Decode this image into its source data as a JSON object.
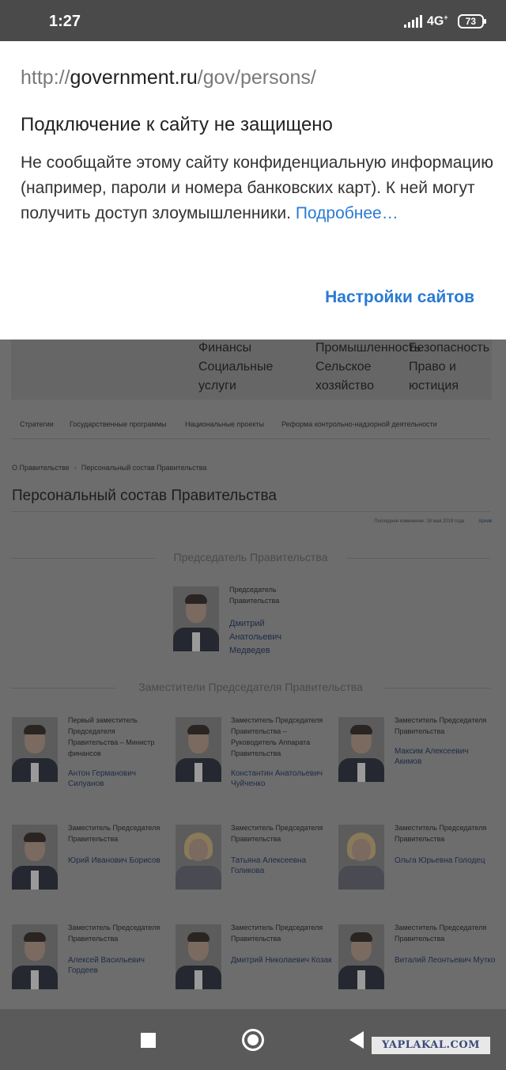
{
  "status_bar": {
    "time": "1:27",
    "network": "4G",
    "network_sup": "+",
    "battery": "73"
  },
  "popup": {
    "url_scheme": "http://",
    "url_domain": "government.ru",
    "url_path": "/gov/persons/",
    "title": "Подключение к сайту не защищено",
    "message": "Не сообщайте этому сайту конфиденциальную информацию (например, пароли и номера банковских карт). К ней могут получить доступ злоумышленники.",
    "more_link": "Подробнее…",
    "settings_button": "Настройки сайтов"
  },
  "menu": {
    "col1": [
      "Финансы",
      "Социальные",
      "услуги"
    ],
    "col2": [
      "Промышленность",
      "Сельское",
      "хозяйство"
    ],
    "col3": [
      "Безопасность",
      "Право и",
      "юстиция"
    ]
  },
  "subnav": [
    "Стратегии",
    "Государственные программы",
    "Национальные проекты",
    "Реформа контрольно-надзорной деятельности"
  ],
  "breadcrumb": [
    "О Правительстве",
    "Персональный состав Правительства"
  ],
  "page_title": "Персональный состав Правительства",
  "updated": {
    "text": "Последнее изменение: 18 мая 2018 года",
    "archive": "Архив"
  },
  "chairman_section": "Председатель Правительства",
  "chairman": {
    "role": "Председатель Правительства",
    "name": "Дмитрий Анатольевич Медведев"
  },
  "deputies_section": "Заместители Председателя Правительства",
  "deputies": [
    {
      "role": "Первый заместитель Председателя Правительства – Министр финансов",
      "name": "Антон Германович Силуанов"
    },
    {
      "role": "Заместитель Председателя Правительства – Руководитель Аппарата Правительства",
      "name": "Константин Анатольевич Чуйченко"
    },
    {
      "role": "Заместитель Председателя Правительства",
      "name": "Максим Алексеевич Акимов"
    },
    {
      "role": "Заместитель Председателя Правительства",
      "name": "Юрий Иванович Борисов"
    },
    {
      "role": "Заместитель Председателя Правительства",
      "name": "Татьяна Алексеевна Голикова"
    },
    {
      "role": "Заместитель Председателя Правительства",
      "name": "Ольга Юрьевна Голодец"
    },
    {
      "role": "Заместитель Председателя Правительства",
      "name": "Алексей Васильевич Гордеев"
    },
    {
      "role": "Заместитель Председателя Правительства",
      "name": "Дмитрий Николаевич Козак"
    },
    {
      "role": "Заместитель Председателя Правительства",
      "name": "Виталий Леонтьевич Мутко"
    }
  ],
  "watermark": "YAPLAKAL.COM"
}
